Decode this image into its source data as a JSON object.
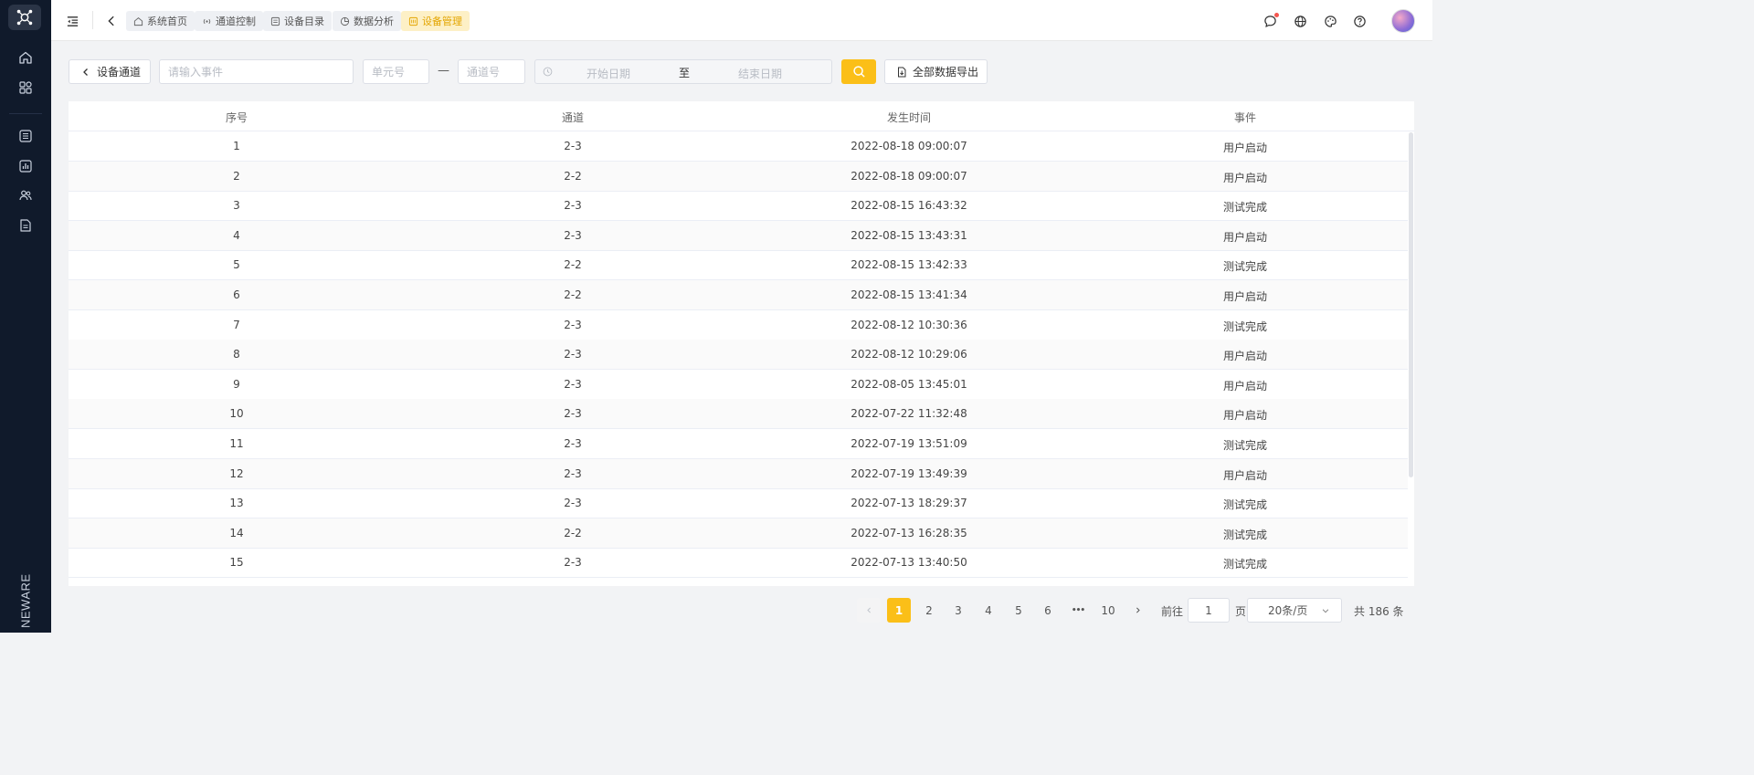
{
  "sidebar": {
    "brand": "NEWARE",
    "icons": [
      "home-icon",
      "apps-icon",
      "list-icon",
      "chart-icon",
      "users-icon",
      "document-icon"
    ]
  },
  "topbar": {
    "tabs": [
      {
        "label": "系统首页",
        "icon": "home-icon"
      },
      {
        "label": "通道控制",
        "icon": "signal-icon"
      },
      {
        "label": "设备目录",
        "icon": "catalog-icon"
      },
      {
        "label": "数据分析",
        "icon": "pie-icon"
      },
      {
        "label": "设备管理",
        "icon": "device-icon",
        "active": true
      }
    ],
    "accent": "#fbbf18"
  },
  "filters": {
    "back_label": "设备通道",
    "event_placeholder": "请输入事件",
    "unit_placeholder": "单元号",
    "separator": "—",
    "channel_placeholder": "通道号",
    "start_placeholder": "开始日期",
    "range_separator": "至",
    "end_placeholder": "结束日期",
    "export_label": "全部数据导出"
  },
  "table": {
    "headers": [
      "序号",
      "通道",
      "发生时间",
      "事件"
    ],
    "rows": [
      [
        "1",
        "2-3",
        "2022-08-18 09:00:07",
        "用户启动"
      ],
      [
        "2",
        "2-2",
        "2022-08-18 09:00:07",
        "用户启动"
      ],
      [
        "3",
        "2-3",
        "2022-08-15 16:43:32",
        "测试完成"
      ],
      [
        "4",
        "2-3",
        "2022-08-15 13:43:31",
        "用户启动"
      ],
      [
        "5",
        "2-2",
        "2022-08-15 13:42:33",
        "测试完成"
      ],
      [
        "6",
        "2-2",
        "2022-08-15 13:41:34",
        "用户启动"
      ],
      [
        "7",
        "2-3",
        "2022-08-12 10:30:36",
        "测试完成"
      ],
      [
        "8",
        "2-3",
        "2022-08-12 10:29:06",
        "用户启动"
      ],
      [
        "9",
        "2-3",
        "2022-08-05 13:45:01",
        "用户启动"
      ],
      [
        "10",
        "2-3",
        "2022-07-22 11:32:48",
        "用户启动"
      ],
      [
        "11",
        "2-3",
        "2022-07-19 13:51:09",
        "测试完成"
      ],
      [
        "12",
        "2-3",
        "2022-07-19 13:49:39",
        "用户启动"
      ],
      [
        "13",
        "2-3",
        "2022-07-13 18:29:37",
        "测试完成"
      ],
      [
        "14",
        "2-2",
        "2022-07-13 16:28:35",
        "测试完成"
      ],
      [
        "15",
        "2-3",
        "2022-07-13 13:40:50",
        "测试完成"
      ]
    ]
  },
  "pagination": {
    "pages": [
      "1",
      "2",
      "3",
      "4",
      "5",
      "6"
    ],
    "ellipsis": "•••",
    "last_page": "10",
    "goto_label": "前往",
    "goto_value": "1",
    "page_suffix": "页",
    "page_size": "20条/页",
    "total": "共 186 条"
  }
}
